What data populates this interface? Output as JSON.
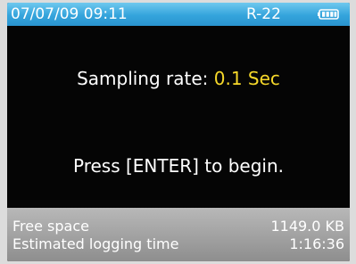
{
  "status_bar": {
    "datetime": "07/07/09 09:11",
    "model": "R-22",
    "battery_icon": "battery-icon"
  },
  "main": {
    "sampling_label": "Sampling rate:",
    "sampling_value": "0.1 Sec",
    "prompt": "Press [ENTER] to begin."
  },
  "footer": {
    "free_space_label": "Free space",
    "free_space_value": "1149.0 KB",
    "logging_time_label": "Estimated logging time",
    "logging_time_value": "1:16:36"
  },
  "colors": {
    "status_bar": "#34a4dc",
    "background": "#050505",
    "highlight": "#f7d92a",
    "footer": "#a3a3a3"
  }
}
